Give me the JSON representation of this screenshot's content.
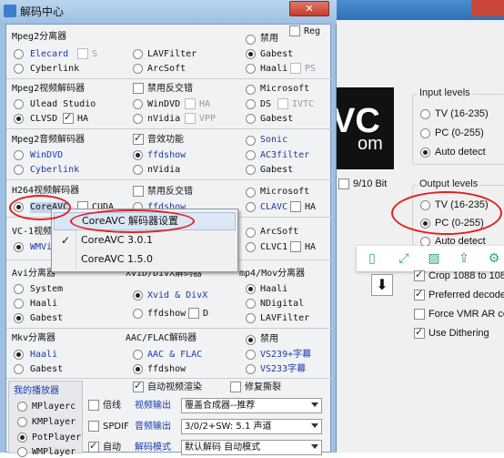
{
  "dialog": {
    "title": "解码中心",
    "mpeg2_split": {
      "header": "Mpeg2分离器",
      "c1": [
        "Elecard",
        "Cyberlink"
      ],
      "c1_s": "S",
      "c2": [
        "LAVFilter",
        "ArcSoft"
      ],
      "c3": [
        "禁用",
        "Gabest",
        "Haali"
      ],
      "c3_ps": "PS",
      "reg": "Reg"
    },
    "mpeg2_video": {
      "header": "Mpeg2视频解码器",
      "c1": [
        "Ulead Studio",
        "CLVSD"
      ],
      "c1_ha": "HA",
      "c2": [
        "禁用反交错",
        "WinDVD",
        "nVidia"
      ],
      "c2_ha": "HA",
      "c2_vpp": "VPP",
      "c3": [
        "Microsoft",
        "DS",
        "Gabest"
      ],
      "c3_ivtc": "IVTC"
    },
    "mpeg2_audio": {
      "header": "Mpeg2音频解码器",
      "c1": [
        "WinDVD",
        "Cyberlink"
      ],
      "c2": [
        "音效功能",
        "ffdshow",
        "nVidia"
      ],
      "c3": [
        "Sonic",
        "AC3filter",
        "Gabest"
      ]
    },
    "h264": {
      "header": "H264视频解码器",
      "c1": "CoreAVC",
      "c1_cuda": "CUDA",
      "c2": [
        "禁用反交错",
        "ffdshow"
      ],
      "c3": [
        "Microsoft",
        "CLAVC"
      ],
      "c3_ha": "HA"
    },
    "vc1": {
      "header": "VC-1视频",
      "c1": "WMVideo",
      "c3": [
        "ArcSoft",
        "CLVC1"
      ],
      "c3_ha": "HA"
    },
    "avi_split": {
      "header": "Avi分离器",
      "c1": [
        "System",
        "Haali",
        "Gabest"
      ]
    },
    "xvid": {
      "header": "XviD/DivX解码器",
      "c2": [
        "Xvid & DivX",
        "ffdshow"
      ],
      "c2_d": "D"
    },
    "mp4": {
      "header": "mp4/Mov分离器",
      "c3": [
        "Haali",
        "NDigital",
        "LAVFilter"
      ]
    },
    "mkv": {
      "header": "Mkv分离器",
      "c1": [
        "Haali",
        "Gabest"
      ]
    },
    "aac": {
      "header": "AAC/FLAC解码器",
      "c2": [
        "AAC & FLAC",
        "ffdshow"
      ]
    },
    "other_audio": {
      "c3": [
        "禁用",
        "VS239+字幕",
        "VS233字幕"
      ]
    },
    "players": {
      "header": "我的播放器",
      "items": [
        "MPlayerc",
        "KMPlayer",
        "PotPlayer",
        "WMPlayer"
      ]
    },
    "bottom": {
      "auto_render": "自动视频渲染",
      "repair": "修复撕裂",
      "double": "倍线",
      "video_out_label": "视频输出",
      "video_out_value": "覆盖合成器--推荐",
      "spdif": "SPDIF",
      "audio_out_label": "音频输出",
      "audio_out_value": "3/0/2+SW: 5.1 声道",
      "auto": "自动",
      "decode_mode_label": "解码模式",
      "decode_mode_value": "默认解码 自动模式"
    }
  },
  "context_menu": {
    "items": [
      "CoreAVC 解码器设置",
      "CoreAVC 3.0.1",
      "CoreAVC 1.5.0"
    ],
    "checked_index": 1
  },
  "bg_window": {
    "logo_text": "VC",
    "logo_sub": "om",
    "bit_label": "9/10 Bit",
    "input_levels": {
      "title": "Input levels",
      "options": [
        "TV (16-235)",
        "PC (0-255)",
        "Auto detect"
      ],
      "selected": 2
    },
    "output_levels": {
      "title": "Output levels",
      "options": [
        "TV (16-235)",
        "PC (0-255)",
        "Auto detect"
      ],
      "selected": 1
    },
    "checks": [
      {
        "label": "Crop 1088 to 108",
        "checked": true
      },
      {
        "label": "Preferred decode",
        "checked": true
      },
      {
        "label": "Force VMR AR co",
        "checked": false
      },
      {
        "label": "Use Dithering",
        "checked": true
      }
    ]
  },
  "colors": {
    "title_bar": "#9ec0e2",
    "annotation": "#e02020",
    "toolbar_icon": "#2aa779",
    "blue_text": "#1a3aa8"
  }
}
